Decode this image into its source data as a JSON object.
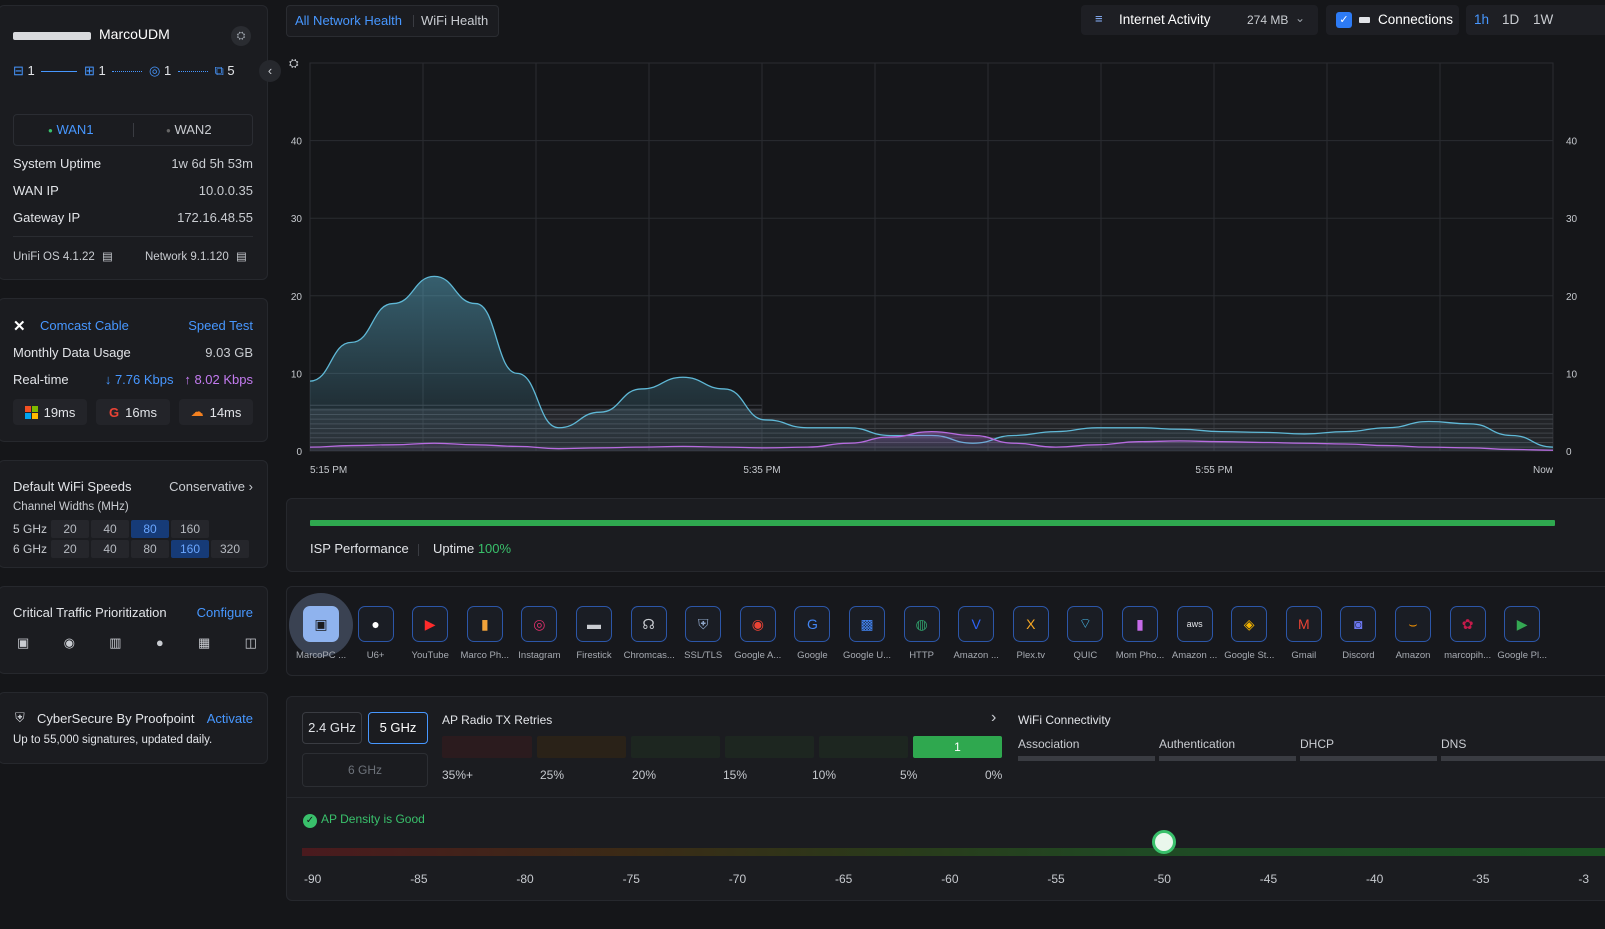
{
  "device": {
    "name": "MarcoUDM",
    "topo_counts": [
      "1",
      "1",
      "1",
      "5"
    ]
  },
  "wan": {
    "wan1": "WAN1",
    "wan2": "WAN2"
  },
  "stats": [
    {
      "label": "System Uptime",
      "value": "1w 6d 5h 53m"
    },
    {
      "label": "WAN IP",
      "value": "10.0.0.35"
    },
    {
      "label": "Gateway IP",
      "value": "172.16.48.55"
    }
  ],
  "versions": {
    "os": "UniFi OS 4.1.22",
    "network": "Network 9.1.120"
  },
  "isp": {
    "name": "Comcast Cable",
    "speed_test": "Speed Test",
    "monthly_label": "Monthly Data Usage",
    "monthly_value": "9.03 GB",
    "realtime_label": "Real-time",
    "down": "7.76 Kbps",
    "up": "8.02 Kbps",
    "latency": [
      "19ms",
      "16ms",
      "14ms"
    ]
  },
  "wifi_speeds": {
    "title": "Default WiFi Speeds",
    "mode": "Conservative",
    "subtitle": "Channel Widths (MHz)",
    "band5": "5 GHz",
    "band5_opts": [
      "20",
      "40",
      "80",
      "160"
    ],
    "band6": "6 GHz",
    "band6_opts": [
      "20",
      "40",
      "80",
      "160",
      "320"
    ]
  },
  "ctp": {
    "title": "Critical Traffic Prioritization",
    "action": "Configure"
  },
  "cyber": {
    "title": "CyberSecure By Proofpoint",
    "action": "Activate",
    "desc": "Up to 55,000 signatures, updated daily."
  },
  "top_tabs": {
    "all": "All Network Health",
    "wifi": "WiFi Health"
  },
  "controls": {
    "activity": "Internet Activity",
    "activity_value": "274 MB",
    "connections": "Connections",
    "ranges": [
      "1h",
      "1D",
      "1W"
    ]
  },
  "chart_data": {
    "type": "area",
    "x_labels": [
      "5:15 PM",
      "5:35 PM",
      "5:55 PM",
      "Now"
    ],
    "ylim": [
      0,
      50
    ],
    "y_ticks": [
      "0",
      "10",
      "20",
      "30",
      "40"
    ],
    "series": [
      {
        "color": "#5fb8d6",
        "values": [
          9,
          14,
          19,
          22.5,
          19,
          10,
          3,
          5,
          8,
          9.5,
          8,
          4,
          3,
          3,
          2,
          2,
          1,
          2,
          2.5,
          3,
          3,
          2.8,
          2.5,
          2.4,
          2.2,
          2.5,
          3,
          3.8,
          3.5,
          2,
          0.5
        ]
      },
      {
        "color": "#b76be0",
        "values": [
          0.5,
          0.7,
          0.8,
          1,
          0.8,
          0.6,
          0.3,
          0.4,
          0.5,
          0.6,
          0.5,
          0.4,
          0.5,
          1,
          1.8,
          2.5,
          2,
          1,
          0.5,
          0.8,
          1.2,
          1.3,
          1.2,
          1.1,
          1.0,
          0.9,
          0.7,
          0.5,
          0.4,
          0.2,
          0.1
        ]
      }
    ]
  },
  "isp_perf": {
    "label": "ISP Performance",
    "uptime_label": "Uptime",
    "uptime_value": "100%"
  },
  "apps": [
    "MarcoPC ...",
    "U6+",
    "YouTube",
    "Marco Ph...",
    "Instagram",
    "Firestick",
    "Chromcas...",
    "SSL/TLS",
    "Google A...",
    "Google",
    "Google U...",
    "HTTP",
    "Amazon ...",
    "Plex.tv",
    "QUIC",
    "Mom Pho...",
    "Amazon ...",
    "Google St...",
    "Gmail",
    "Discord",
    "Amazon",
    "marcopih...",
    "Google Pl..."
  ],
  "radio": {
    "bands": [
      "2.4 GHz",
      "5 GHz",
      "6 GHz"
    ],
    "title": "AP Radio TX Retries",
    "retry_labels": [
      "35%+",
      "25%",
      "20%",
      "15%",
      "10%",
      "5%",
      "0%"
    ],
    "active_count": "1"
  },
  "connectivity": {
    "title": "WiFi Connectivity",
    "steps": [
      "Association",
      "Authentication",
      "DHCP",
      "DNS"
    ]
  },
  "density": {
    "status": "AP Density is Good",
    "scale": [
      "-90",
      "-85",
      "-80",
      "-75",
      "-70",
      "-65",
      "-60",
      "-55",
      "-50",
      "-45",
      "-40",
      "-35",
      "-3"
    ],
    "value": -50
  }
}
